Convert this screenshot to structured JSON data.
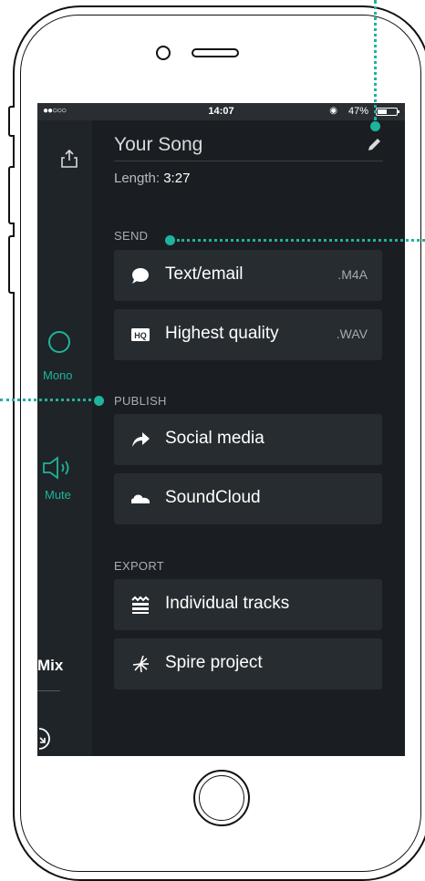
{
  "status_bar": {
    "signal": "●●○○○",
    "time": "14:07",
    "battery_percent": "47%"
  },
  "sidebar": {
    "mono_label": "Mono",
    "mute_label": "Mute",
    "mix_label": "Mix"
  },
  "song": {
    "title": "Your Song",
    "length_label": "Length:",
    "length_value": "3:27"
  },
  "sections": {
    "send": {
      "label": "SEND",
      "items": [
        {
          "label": "Text/email",
          "ext": ".M4A",
          "icon": "speech-bubble-icon"
        },
        {
          "label": "Highest quality",
          "ext": ".WAV",
          "icon": "hq-icon"
        }
      ]
    },
    "publish": {
      "label": "PUBLISH",
      "items": [
        {
          "label": "Social media",
          "icon": "share-arrow-icon"
        },
        {
          "label": "SoundCloud",
          "icon": "soundcloud-icon"
        }
      ]
    },
    "export": {
      "label": "EXPORT",
      "items": [
        {
          "label": "Individual tracks",
          "icon": "tracks-icon"
        },
        {
          "label": "Spire project",
          "icon": "spire-icon"
        }
      ]
    }
  },
  "colors": {
    "accent": "#1fb39b",
    "screen_bg": "#1a1e22",
    "row_bg": "#272c30"
  }
}
